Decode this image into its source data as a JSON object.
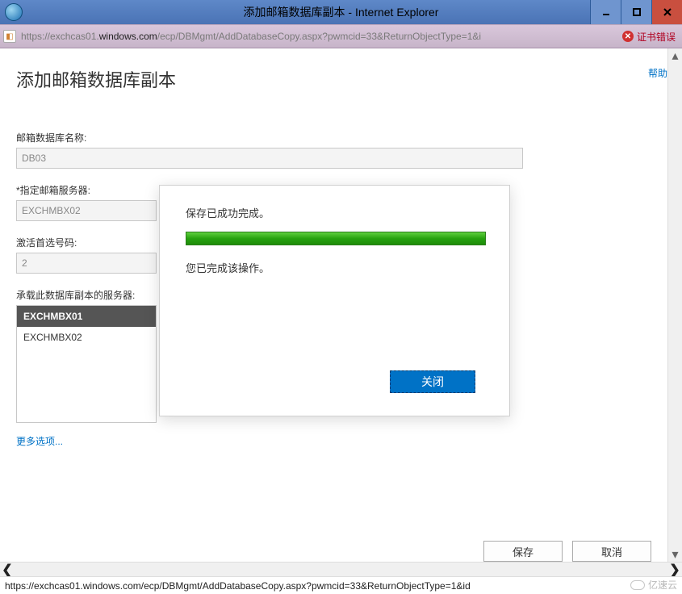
{
  "window": {
    "title": "添加邮箱数据库副本 - Internet Explorer"
  },
  "addressbar": {
    "url_prefix": "https://exchcas01.",
    "url_host": "windows.com",
    "url_suffix": "/ecp/DBMgmt/AddDatabaseCopy.aspx?pwmcid=33&ReturnObjectType=1&i",
    "cert_error_label": "证书错误"
  },
  "page": {
    "heading": "添加邮箱数据库副本",
    "help_label": "帮助",
    "db_name_label": "邮箱数据库名称:",
    "db_name_value": "DB03",
    "mailbox_server_label": "*指定邮箱服务器:",
    "mailbox_server_value": "EXCHMBX02",
    "activation_pref_label": "激活首选号码:",
    "activation_pref_value": "2",
    "hosting_servers_label": "承载此数据库副本的服务器:",
    "servers": [
      {
        "name": "EXCHMBX01",
        "selected": true
      },
      {
        "name": "EXCHMBX02",
        "selected": false
      }
    ],
    "more_options_label": "更多选项...",
    "save_label": "保存",
    "cancel_label": "取消"
  },
  "modal": {
    "line1": "保存已成功完成。",
    "line2": "您已完成该操作。",
    "close_label": "关闭"
  },
  "statusbar": {
    "url": "https://exchcas01.windows.com/ecp/DBMgmt/AddDatabaseCopy.aspx?pwmcid=33&ReturnObjectType=1&id"
  },
  "watermark": {
    "text": "亿速云"
  }
}
